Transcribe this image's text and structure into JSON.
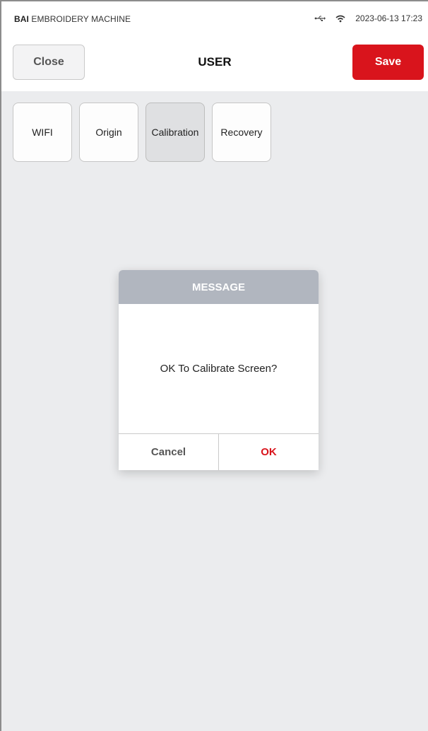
{
  "statusbar": {
    "brand_bold": "BAI",
    "brand_rest": " EMBROIDERY MACHINE",
    "datetime": "2023-06-13 17:23",
    "icons": [
      "usb-icon",
      "wifi-icon"
    ]
  },
  "header": {
    "close_label": "Close",
    "title": "USER",
    "save_label": "Save"
  },
  "tabs": [
    {
      "label": "WIFI",
      "active": false
    },
    {
      "label": "Origin",
      "active": false
    },
    {
      "label": "Calibration",
      "active": true
    },
    {
      "label": "Recovery",
      "active": false
    }
  ],
  "dialog": {
    "title": "MESSAGE",
    "message": "OK To Calibrate Screen?",
    "cancel_label": "Cancel",
    "ok_label": "OK"
  },
  "colors": {
    "accent": "#d9141c",
    "dialog_header": "#b1b6bf",
    "background": "#ebecee"
  }
}
